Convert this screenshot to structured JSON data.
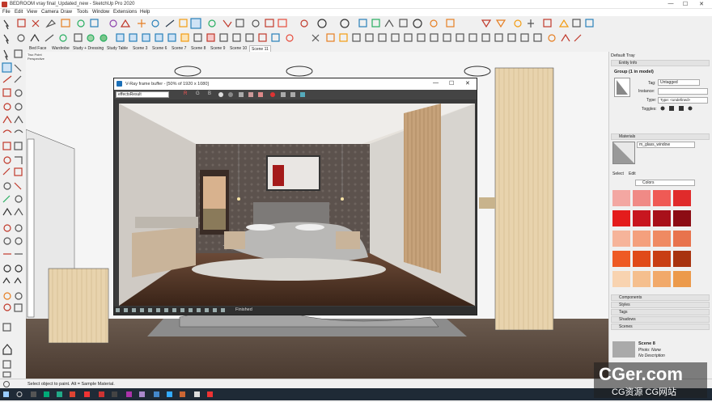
{
  "window": {
    "title": "BEDROOM vray final_Updated_new - SketchUp Pro 2020",
    "controls": [
      "—",
      "☐",
      "✕"
    ]
  },
  "menu": [
    "File",
    "Edit",
    "View",
    "Camera",
    "Draw",
    "Tools",
    "Window",
    "Extensions",
    "Help"
  ],
  "scenes": [
    "Bed Face",
    "Wardrobe",
    "Study + Dressing",
    "Study Table",
    "Scene 3",
    "Scene 6",
    "Scene 7",
    "Scene 8",
    "Scene 9",
    "Scene 10",
    "Scene 11"
  ],
  "active_scene": "Scene 11",
  "viewport": {
    "camera_labels": [
      "Two Point",
      "Perspective"
    ]
  },
  "vfb": {
    "title": "V-Ray frame buffer - [50% of 1920 x 1080]",
    "channel": "effectsResult",
    "channel_buttons": [
      "R",
      "G",
      "B"
    ],
    "status": "Finished",
    "controls": [
      "—",
      "☐",
      "✕"
    ]
  },
  "tray": {
    "title": "Default Tray",
    "entity_info": {
      "header": "Entity Info",
      "group_label": "Group (1 in model)",
      "tag_label": "Tag:",
      "tag_value": "Untagged",
      "instance_label": "Instance:",
      "type_label": "Type:",
      "type_value": "Type: <undefined>",
      "toggles_label": "Toggles:"
    },
    "materials": {
      "header": "Materials",
      "material_name": "m_glass_window",
      "tabs": [
        "Select",
        "Edit"
      ],
      "library": "Colors"
    },
    "collapsed": [
      "Components",
      "Styles",
      "Tags",
      "Shadows",
      "Scenes"
    ],
    "scene_detail": {
      "name": "Scene 8",
      "photo_label": "Photo:",
      "photo_value": "None",
      "description": "No Description"
    }
  },
  "status": {
    "hint": "Select object to paint. Alt = Sample Material."
  },
  "watermark": {
    "brand": "CGer.com",
    "sub": "CG资源 CG网站"
  },
  "colors": {
    "swatches": [
      "#f3a7a2",
      "#f08a86",
      "#ef5a55",
      "#e02b2b",
      "#e41c1c",
      "#c8161f",
      "#a8101a",
      "#8c0c14",
      "#f6b49a",
      "#f4a07d",
      "#ef8a62",
      "#e8734d",
      "#ee5a24",
      "#e04a19",
      "#c83e14",
      "#a8330f",
      "#f8d3b0",
      "#f5bf8e",
      "#f1a96a",
      "#ec9a4b"
    ]
  }
}
